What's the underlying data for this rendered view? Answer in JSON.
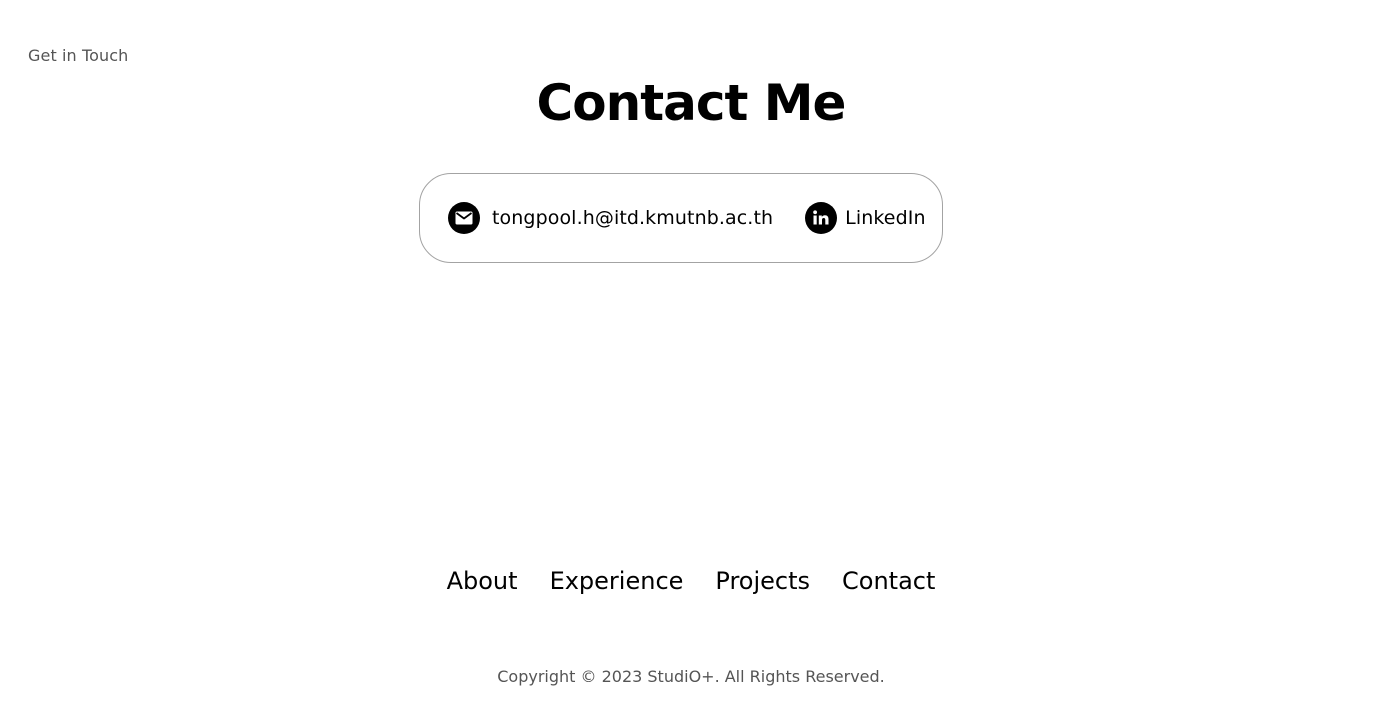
{
  "section": {
    "eyebrow": "Get in Touch",
    "title": "Contact Me"
  },
  "contacts": {
    "email": {
      "icon": "mail-icon",
      "text": "tongpool.h@itd.kmutnb.ac.th"
    },
    "linkedin": {
      "icon": "linkedin-icon",
      "text": "LinkedIn"
    }
  },
  "footer": {
    "nav": [
      "About",
      "Experience",
      "Projects",
      "Contact"
    ],
    "copyright": "Copyright © 2023 StudiO+. All Rights Reserved."
  },
  "colors": {
    "text": "#000000",
    "muted": "#555555",
    "border": "#a3a3a3",
    "background": "#ffffff"
  }
}
